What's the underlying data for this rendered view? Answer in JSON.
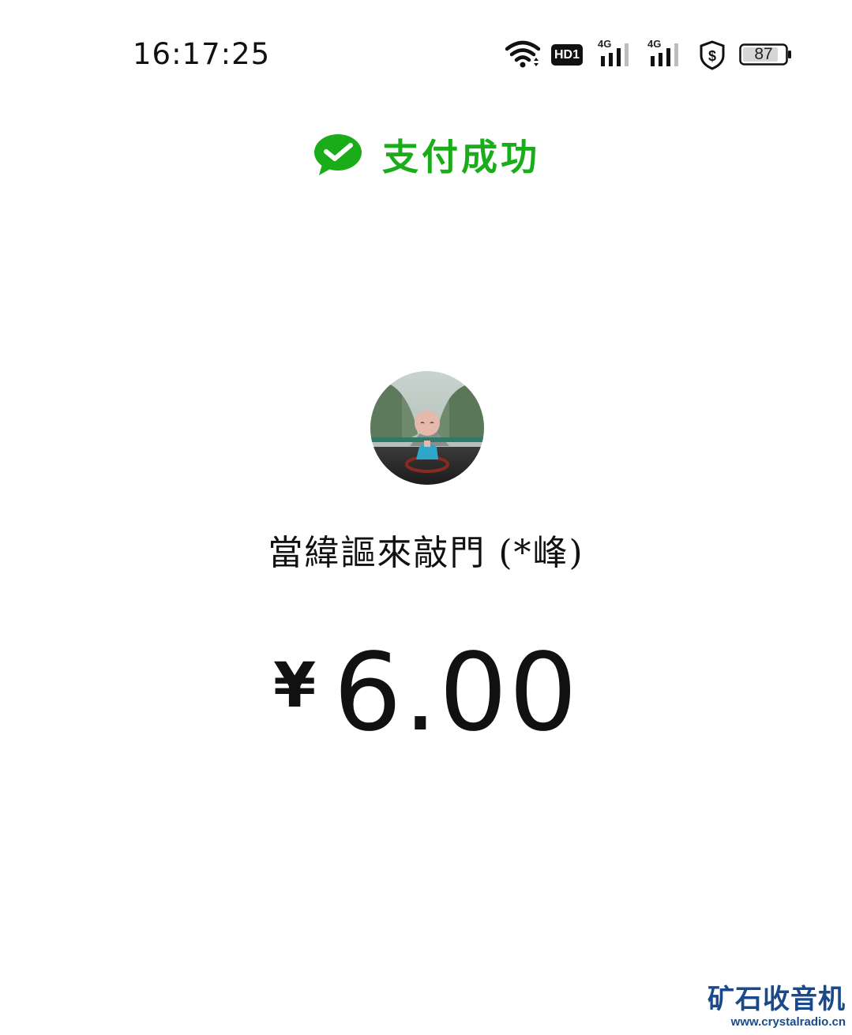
{
  "status_bar": {
    "time": "16:17:25",
    "hd_label": "HD1",
    "network_1": "4G",
    "network_2": "4G",
    "battery": "87"
  },
  "header": {
    "title": "支付成功",
    "icon": "wechat-pay-check-icon",
    "accent_color": "#1aad19"
  },
  "payment": {
    "payee": "當緯謳來敲門 (*峰)",
    "currency_symbol": "¥",
    "amount": "6.00"
  },
  "watermark": {
    "brand": "矿石收音机",
    "url": "www.crystalradio.cn"
  }
}
